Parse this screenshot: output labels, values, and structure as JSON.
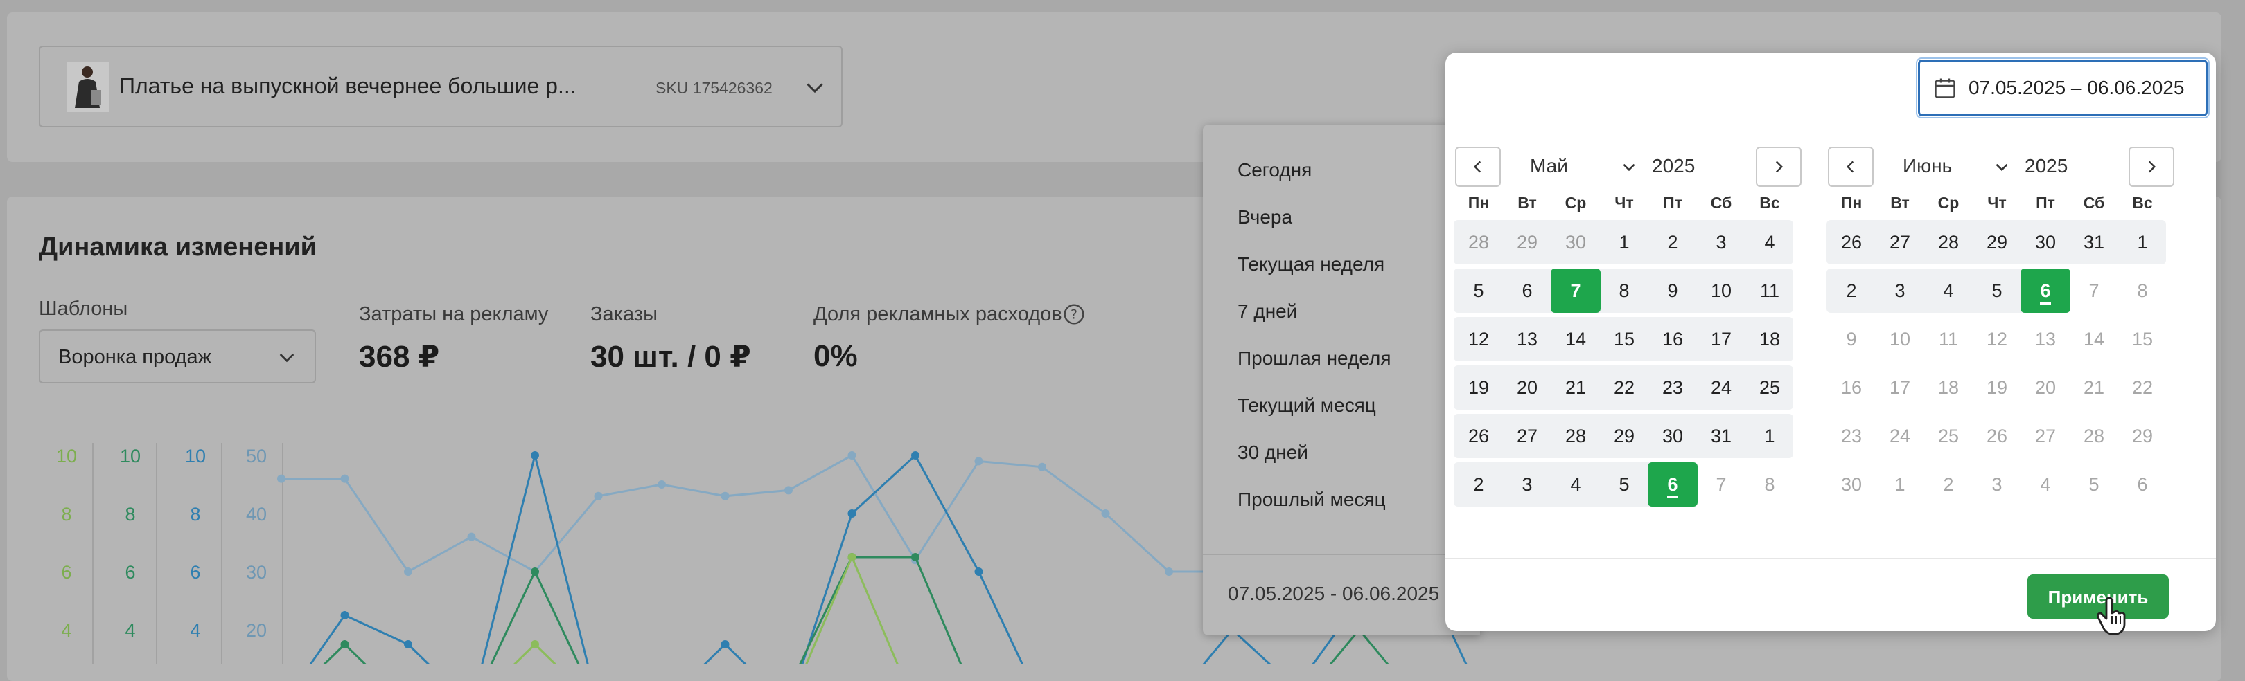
{
  "product": {
    "name": "Платье на выпускной вечернее большие р...",
    "sku": "SKU 175426362"
  },
  "dashboard": {
    "title": "Динамика изменений",
    "templates": {
      "label": "Шаблоны",
      "value": "Воронка продаж"
    },
    "metrics": [
      {
        "label": "Затраты на рекламу",
        "value": "368 ₽"
      },
      {
        "label": "Заказы",
        "value": "30 шт. / 0 ₽"
      },
      {
        "label": "Доля рекламных расходов",
        "value": "0%"
      }
    ]
  },
  "chart_data": {
    "type": "line",
    "axes": [
      {
        "ticks": [
          "10",
          "8",
          "6",
          "4"
        ],
        "color": "#7cae4e"
      },
      {
        "ticks": [
          "10",
          "8",
          "6",
          "4"
        ],
        "color": "#2f8a5e"
      },
      {
        "ticks": [
          "10",
          "8",
          "6",
          "4"
        ],
        "color": "#2f7fb0"
      },
      {
        "ticks": [
          "50",
          "40",
          "30",
          "20"
        ],
        "color": "#6e97b3"
      }
    ],
    "series": [
      {
        "color": "#86a9c2",
        "axis": 3,
        "values": [
          46,
          46,
          30,
          36,
          30,
          43,
          45,
          43,
          44,
          50,
          32,
          49,
          48,
          40,
          30,
          30,
          35,
          40,
          42,
          44,
          44
        ]
      },
      {
        "color": "#2f7fb0",
        "axis": 2,
        "values": [
          0,
          4.5,
          3.5,
          0,
          10,
          0,
          0,
          3.5,
          1,
          8,
          10,
          6,
          0,
          0,
          0,
          4,
          2,
          5,
          6,
          0,
          0
        ]
      },
      {
        "color": "#2f8a5e",
        "axis": 1,
        "values": [
          0,
          3.5,
          0,
          0,
          6,
          0,
          0,
          0,
          2,
          6.5,
          6.5,
          0,
          0,
          0,
          0,
          2,
          0,
          4,
          0,
          0,
          0
        ]
      },
      {
        "color": "#8cbc5c",
        "axis": 0,
        "values": [
          0,
          0,
          0,
          0,
          3.5,
          0,
          0,
          0,
          0,
          6.5,
          0,
          0,
          0,
          0,
          0,
          0,
          0,
          0,
          0,
          0,
          0
        ]
      }
    ]
  },
  "shortcuts": {
    "items": [
      "Сегодня",
      "Вчера",
      "Текущая неделя",
      "7 дней",
      "Прошлая неделя",
      "Текущий месяц",
      "30 дней",
      "Прошлый месяц"
    ],
    "range": "07.05.2025 - 06.06.2025"
  },
  "picker": {
    "input_value": "07.05.2025 – 06.06.2025",
    "weekdays": [
      "Пн",
      "Вт",
      "Ср",
      "Чт",
      "Пт",
      "Сб",
      "Вс"
    ],
    "months": [
      {
        "month": "Май",
        "year": "2025",
        "days": [
          [
            "28",
            "29",
            "30",
            "1",
            "2",
            "3",
            "4"
          ],
          [
            "5",
            "6",
            "7",
            "8",
            "9",
            "10",
            "11"
          ],
          [
            "12",
            "13",
            "14",
            "15",
            "16",
            "17",
            "18"
          ],
          [
            "19",
            "20",
            "21",
            "22",
            "23",
            "24",
            "25"
          ],
          [
            "26",
            "27",
            "28",
            "29",
            "30",
            "31",
            "1"
          ],
          [
            "2",
            "3",
            "4",
            "5",
            "6",
            "7",
            "8"
          ]
        ]
      },
      {
        "month": "Июнь",
        "year": "2025",
        "days": [
          [
            "26",
            "27",
            "28",
            "29",
            "30",
            "31",
            "1"
          ],
          [
            "2",
            "3",
            "4",
            "5",
            "6",
            "7",
            "8"
          ],
          [
            "9",
            "10",
            "11",
            "12",
            "13",
            "14",
            "15"
          ],
          [
            "16",
            "17",
            "18",
            "19",
            "20",
            "21",
            "22"
          ],
          [
            "23",
            "24",
            "25",
            "26",
            "27",
            "28",
            "29"
          ],
          [
            "30",
            "1",
            "2",
            "3",
            "4",
            "5",
            "6"
          ]
        ]
      }
    ],
    "apply_label": "Применить"
  }
}
